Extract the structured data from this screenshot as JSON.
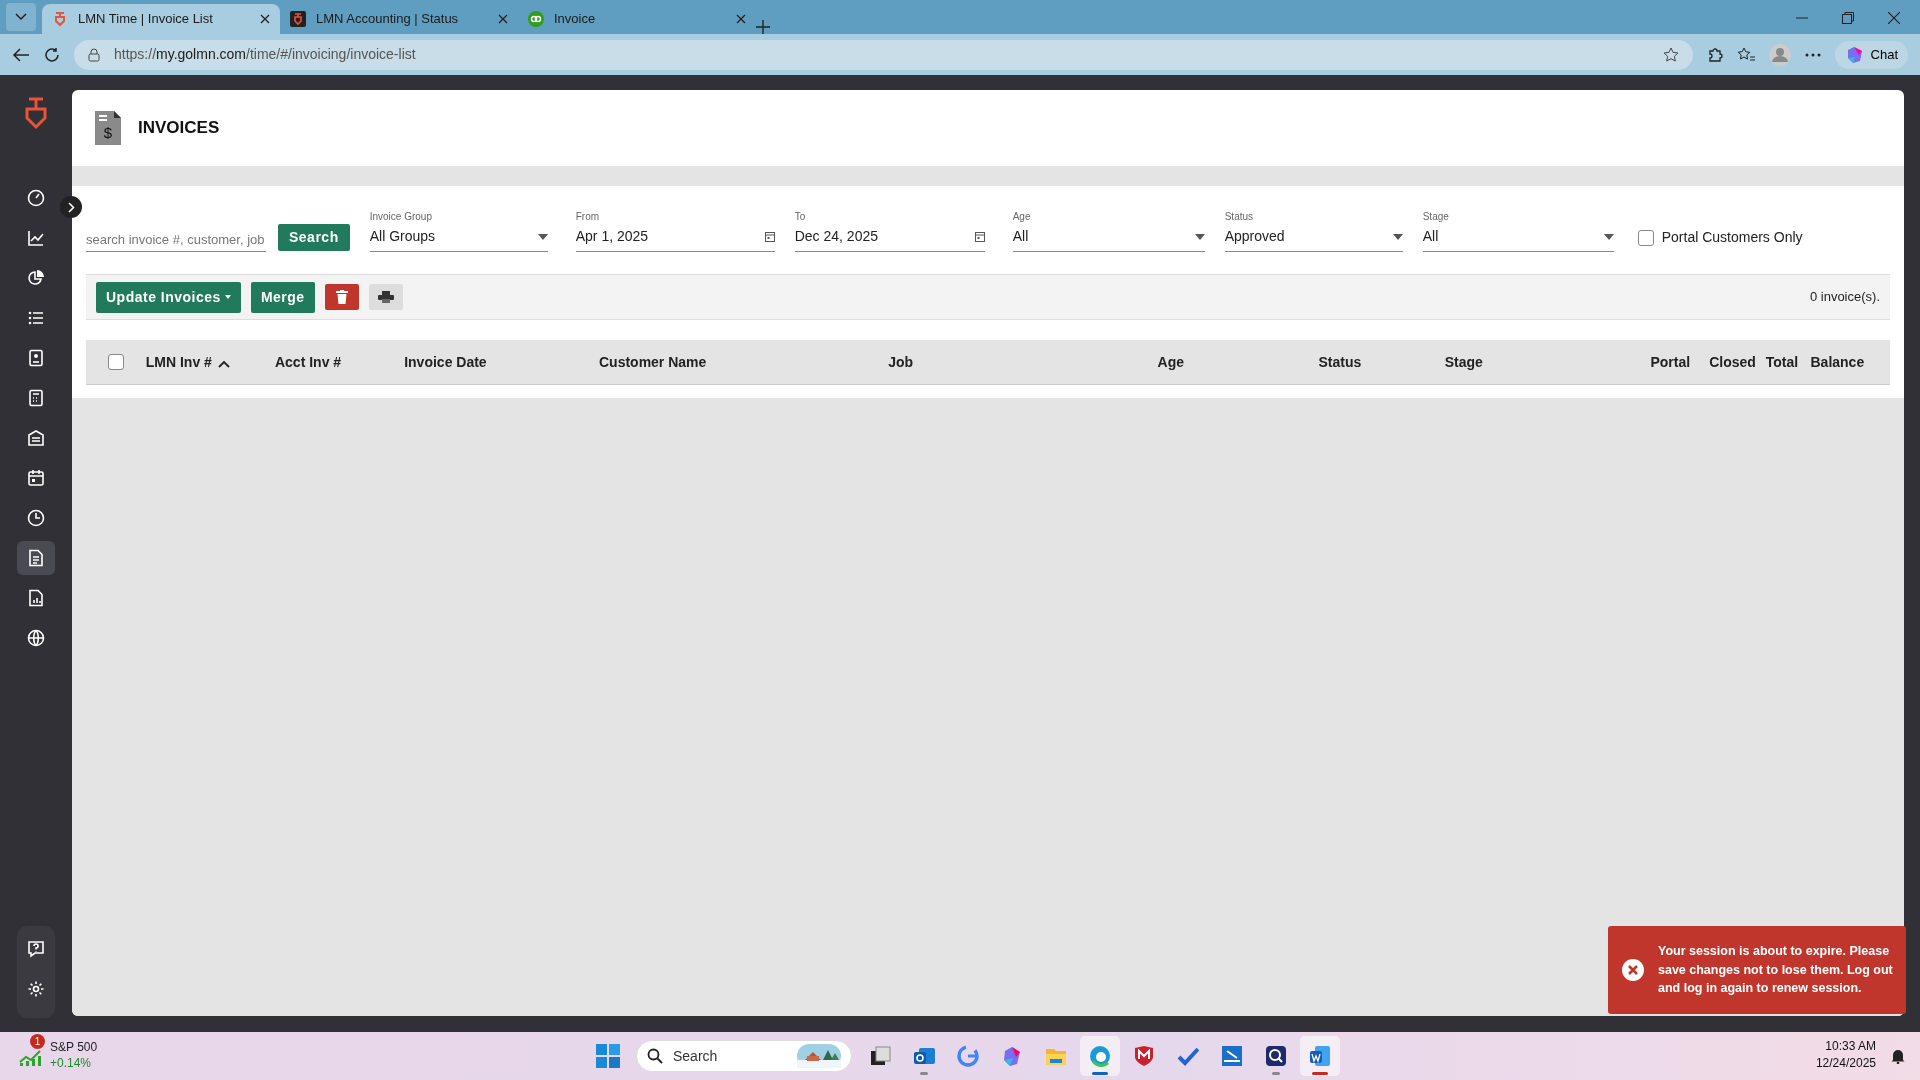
{
  "browser": {
    "tabs": [
      {
        "title": "LMN Time | Invoice List",
        "selected": true
      },
      {
        "title": "LMN Accounting | Status",
        "selected": false
      },
      {
        "title": "Invoice",
        "selected": false
      }
    ],
    "url": "https://**my.golmn.com**/time/#/invoicing/invoice-list",
    "chat": "Chat"
  },
  "sidebar": {
    "items": [
      {
        "selected": false
      },
      {
        "selected": false
      },
      {
        "selected": false
      },
      {
        "selected": false
      },
      {
        "selected": false
      },
      {
        "selected": false
      },
      {
        "selected": false
      },
      {
        "selected": false
      },
      {
        "selected": false
      },
      {
        "selected": true
      },
      {
        "selected": false
      },
      {
        "selected": false
      }
    ],
    "footer_items": [
      {
        "selected": false
      },
      {
        "selected": false
      }
    ]
  },
  "page": {
    "title_icon": "$",
    "title": "INVOICES",
    "search": {
      "placeholder": "search invoice #, customer, job",
      "button": "Search"
    },
    "filters": [
      {
        "kind": "select",
        "label": "Invoice Group",
        "value": "All Groups"
      },
      {
        "kind": "date",
        "label": "From",
        "value": "Apr 1, 2025"
      },
      {
        "kind": "date",
        "label": "To",
        "value": "Dec 24, 2025"
      },
      {
        "kind": "select",
        "label": "Age",
        "value": "All"
      },
      {
        "kind": "select",
        "label": "Status",
        "value": "Approved"
      },
      {
        "kind": "select",
        "label": "Stage",
        "value": "All"
      }
    ],
    "portal_only": {
      "label": "Portal Customers Only",
      "checked": false
    },
    "toolbar": {
      "update": "Update Invoices",
      "merge": "Merge",
      "count": "0 invoice(s)."
    },
    "table": {
      "select_all": false,
      "columns": [
        {
          "label": "LMN Inv #",
          "sorted": true
        },
        {
          "label": "Acct Inv #",
          "sorted": false
        },
        {
          "label": "Invoice Date",
          "sorted": false
        },
        {
          "label": "Customer Name",
          "sorted": false
        },
        {
          "label": "Job",
          "sorted": false
        },
        {
          "label": "Age",
          "sorted": false
        },
        {
          "label": "Status",
          "sorted": false
        },
        {
          "label": "Stage",
          "sorted": false
        },
        {
          "label": "Portal",
          "sorted": false
        },
        {
          "label": "Closed",
          "sorted": false
        },
        {
          "label": "Total",
          "sorted": false
        },
        {
          "label": "Balance",
          "sorted": false
        }
      ]
    }
  },
  "toast": {
    "message": "Your session is about to expire. Please save changes not to lose them. Log out and log in again to renew session."
  },
  "taskbar": {
    "widget": {
      "badge": "1",
      "name": "S&P 500",
      "change": "+0.14%"
    },
    "search": {
      "placeholder": "Search"
    },
    "apps": [
      {
        "open": false,
        "selected": false
      },
      {
        "open": true,
        "selected": false
      },
      {
        "open": false,
        "selected": false
      },
      {
        "open": false,
        "selected": false
      },
      {
        "open": false,
        "selected": false
      },
      {
        "open": true,
        "selected": true
      },
      {
        "open": false,
        "selected": false
      },
      {
        "open": false,
        "selected": false
      },
      {
        "open": false,
        "selected": false
      },
      {
        "open": true,
        "selected": false
      },
      {
        "open": true,
        "selected": true
      }
    ],
    "time": "10:33 AM",
    "date": "12/24/2025"
  }
}
